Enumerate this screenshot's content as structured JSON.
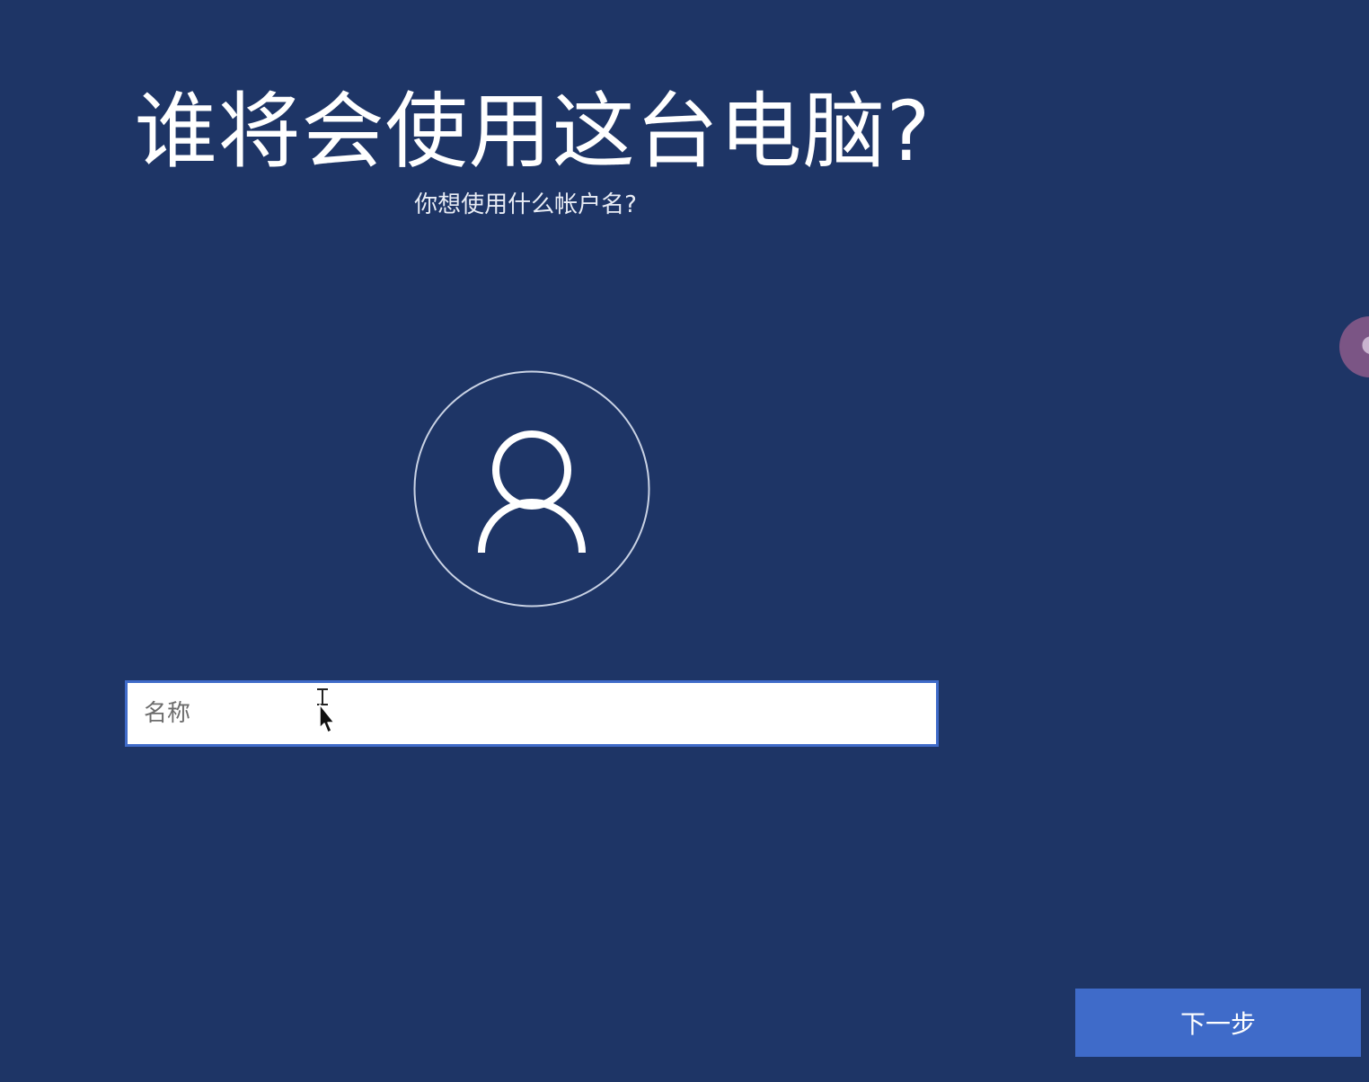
{
  "page": {
    "title": "谁将会使用这台电脑?",
    "subtitle": "你想使用什么帐户名?"
  },
  "account_form": {
    "name_input": {
      "value": "",
      "placeholder": "名称"
    }
  },
  "footer": {
    "next_label": "下一步"
  },
  "icons": {
    "avatar": "user-silhouette-icon",
    "cursor": "mouse-pointer-icon"
  },
  "colors": {
    "background": "#1e3566",
    "accent": "#3f6bc9",
    "input_background": "#ffffff",
    "side_handle": "#7b5585"
  }
}
